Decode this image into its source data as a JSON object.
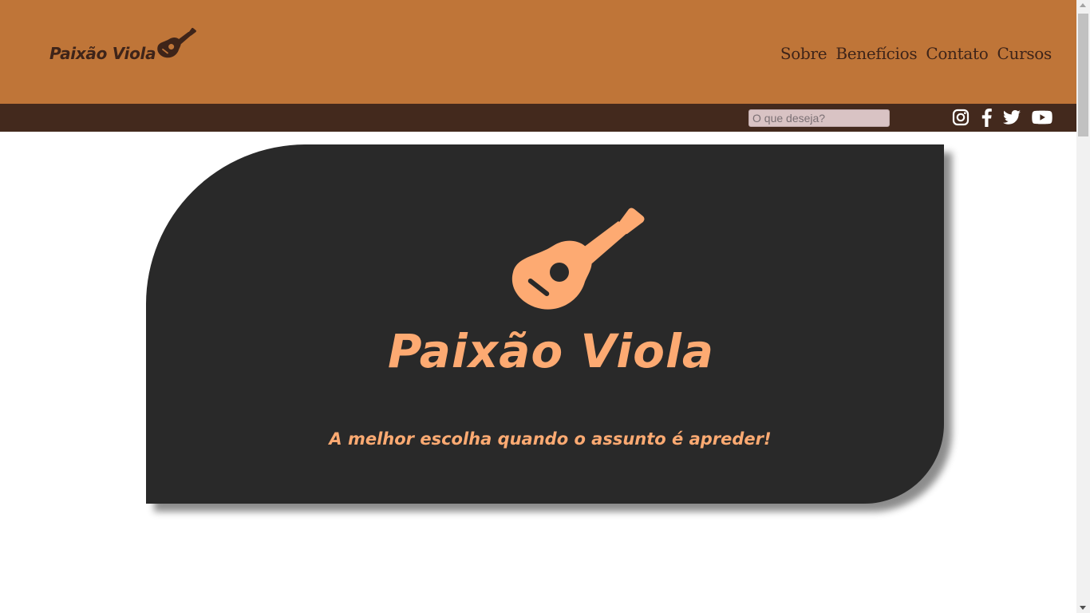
{
  "brand": {
    "name": "Paixão Viola",
    "logo_icon": "guitar-icon",
    "primary_color": "#bf7538",
    "dark_color": "#43291d",
    "text_color": "#3e2419",
    "accent_color": "#fdaa72"
  },
  "nav": {
    "items": [
      {
        "label": "Sobre"
      },
      {
        "label": "Benefícios"
      },
      {
        "label": "Contato"
      },
      {
        "label": "Cursos"
      }
    ]
  },
  "search": {
    "placeholder": "O que deseja?",
    "value": ""
  },
  "social": {
    "icons": [
      "instagram-icon",
      "facebook-icon",
      "twitter-icon",
      "youtube-icon"
    ]
  },
  "hero": {
    "title": "Paixão Viola",
    "tagline": "A melhor escolha quando o assunto é apreder!",
    "icon": "guitar-icon",
    "background": "#292929"
  }
}
